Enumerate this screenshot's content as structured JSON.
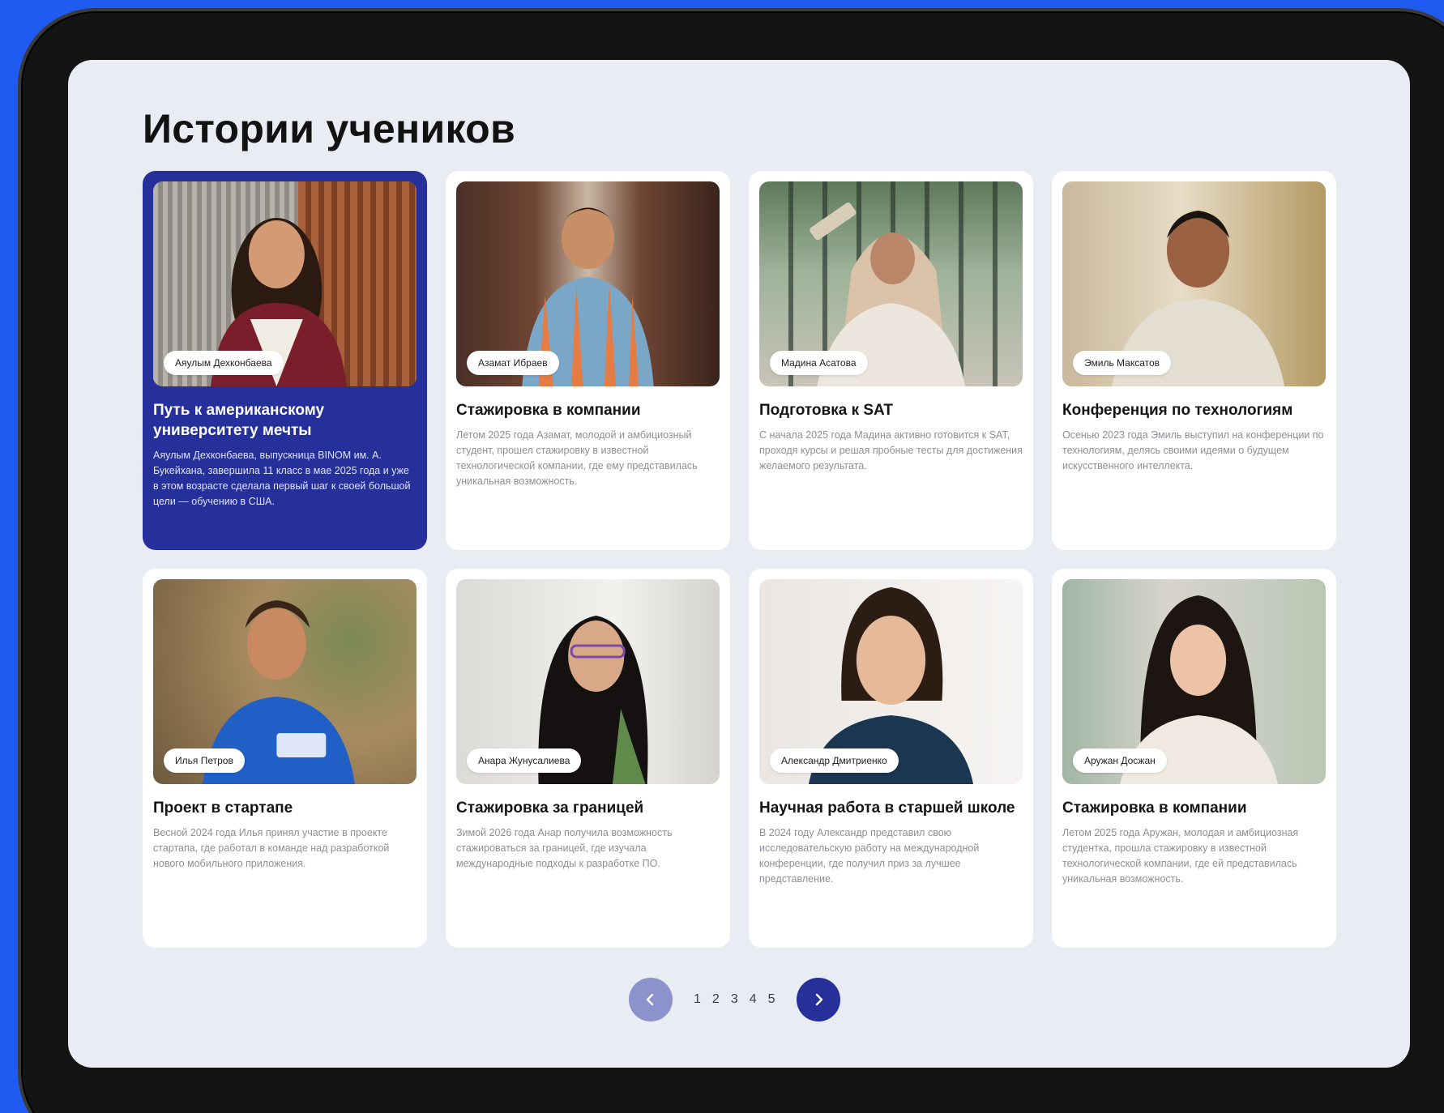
{
  "section": {
    "title": "Истории учеников"
  },
  "cards": [
    {
      "name": "Аяулым Дехконбаева",
      "title": "Путь к американскому университету мечты",
      "text": "Аяулым Дехконбаева, выпускница BINOM им. А. Букейхана, завершила 11 класс в мае 2025 года и уже в этом возрасте сделала первый шаг к своей большой цели — обучению в США.",
      "featured": true
    },
    {
      "name": "Азамат Ибраев",
      "title": "Стажировка в компании",
      "text": "Летом 2025 года Азамат, молодой и амбициозный студент, прошел стажировку в известной технологической компании, где ему представилась уникальная возможность.",
      "featured": false
    },
    {
      "name": "Мадина Асатова",
      "title": "Подготовка к SAT",
      "text": "С начала 2025 года Мадина активно готовится к SAT, проходя курсы и решая пробные тесты для достижения желаемого результата.",
      "featured": false
    },
    {
      "name": "Эмиль Максатов",
      "title": "Конференция по технологиям",
      "text": "Осенью 2023 года Эмиль выступил на конференции по технологиям, делясь своими идеями о будущем искусственного интеллекта.",
      "featured": false
    },
    {
      "name": "Илья Петров",
      "title": "Проект в стартапе",
      "text": "Весной 2024 года Илья принял участие в проекте стартапа, где работал в команде над разработкой нового мобильного приложения.",
      "featured": false
    },
    {
      "name": "Анара Жунусалиева",
      "title": "Стажировка за границей",
      "text": "Зимой 2026 года Анар получила возможность стажироваться за границей, где изучала международные подходы к разработке ПО.",
      "featured": false
    },
    {
      "name": "Александр Дмитриенко",
      "title": "Научная работа в старшей школе",
      "text": "В 2024 году Александр представил свою исследовательскую работу на международной конференции, где получил приз за лучшее представление.",
      "featured": false
    },
    {
      "name": "Аружан Досжан",
      "title": "Стажировка в компании",
      "text": "Летом 2025 года Аружан, молодая и амбициозная студентка, прошла стажировку в известной технологической компании, где ей представилась уникальная возможность.",
      "featured": false
    }
  ],
  "pagination": {
    "pages": [
      "1",
      "2",
      "3",
      "4",
      "5"
    ],
    "prev_icon": "chevron-left-icon",
    "next_icon": "chevron-right-icon"
  },
  "colors": {
    "accent": "#26309a",
    "accent_light": "#8c92cc",
    "frame_background": "#1f5bf0",
    "screen_background": "#e9edf3"
  }
}
